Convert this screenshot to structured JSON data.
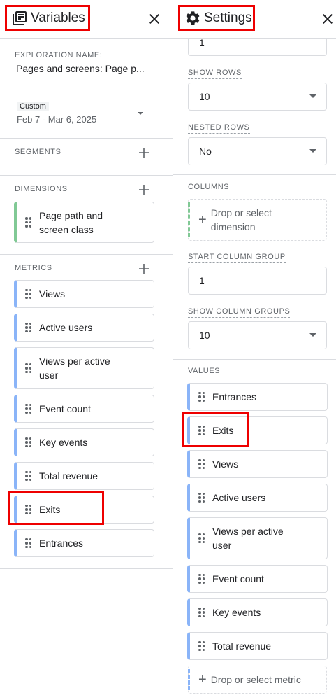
{
  "variables": {
    "title": "Variables",
    "exploration_name_label": "EXPLORATION NAME:",
    "exploration_name": "Pages and screens: Page p...",
    "date_badge": "Custom",
    "date_range": "Feb 7 - Mar 6, 2025",
    "segments_label": "SEGMENTS",
    "dimensions_label": "DIMENSIONS",
    "dimensions": [
      "Page path and screen class"
    ],
    "metrics_label": "METRICS",
    "metrics": [
      "Views",
      "Active users",
      "Views per active user",
      "Event count",
      "Key events",
      "Total revenue",
      "Exits",
      "Entrances"
    ]
  },
  "settings": {
    "title": "Settings",
    "top_value": "1",
    "show_rows_label": "SHOW ROWS",
    "show_rows": "10",
    "nested_rows_label": "NESTED ROWS",
    "nested_rows": "No",
    "columns_label": "COLUMNS",
    "columns_placeholder": "Drop or select dimension",
    "start_column_group_label": "START COLUMN GROUP",
    "start_column_group": "1",
    "show_column_groups_label": "SHOW COLUMN GROUPS",
    "show_column_groups": "10",
    "values_label": "VALUES",
    "values": [
      "Entrances",
      "Exits",
      "Views",
      "Active users",
      "Views per active user",
      "Event count",
      "Key events",
      "Total revenue"
    ],
    "values_placeholder": "Drop or select metric"
  },
  "colors": {
    "highlight": "#ee0000",
    "metric_accent": "#8ab4f8",
    "dimension_accent": "#81c995"
  },
  "icons": {
    "variables": "variables-list-icon",
    "settings": "gear-icon",
    "close": "close-icon",
    "add": "plus-icon",
    "grip": "drag-handle-icon",
    "dropdown": "caret-down-icon"
  }
}
